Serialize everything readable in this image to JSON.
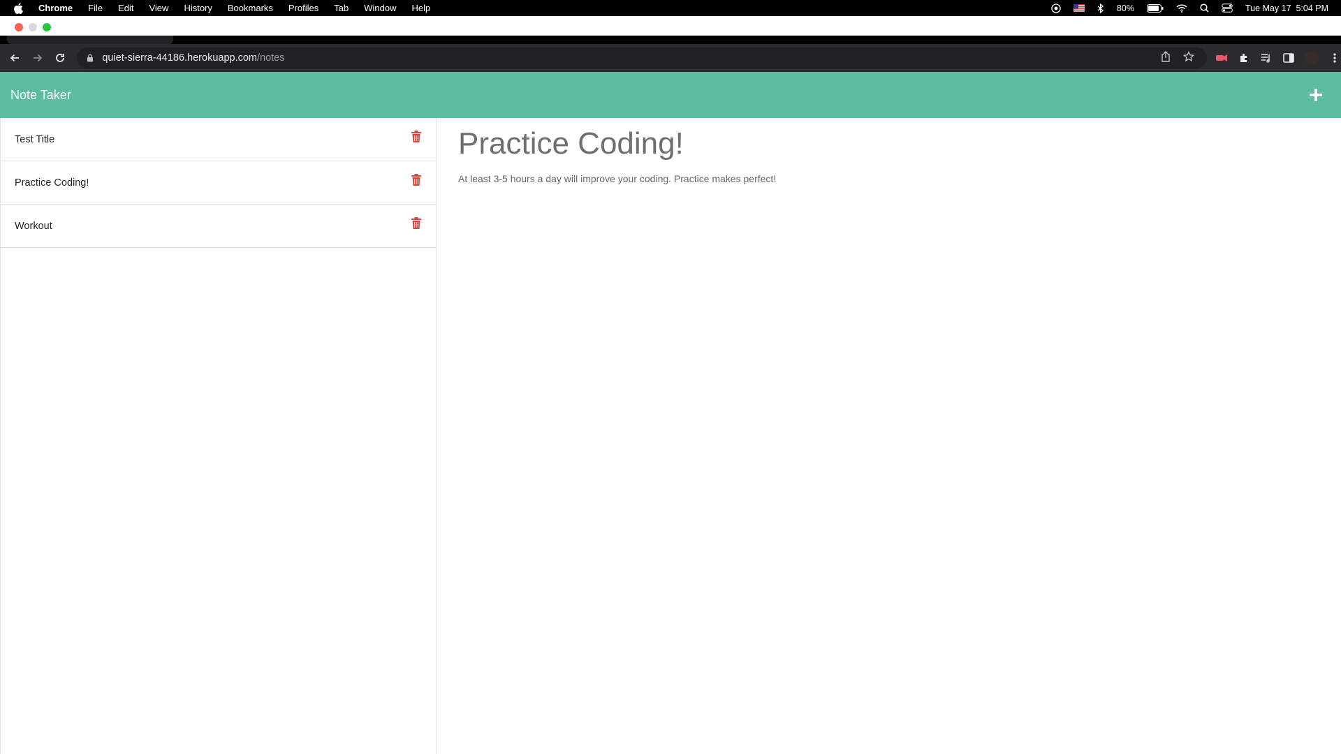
{
  "menubar": {
    "app_name": "Chrome",
    "items": [
      "File",
      "Edit",
      "View",
      "History",
      "Bookmarks",
      "Profiles",
      "Tab",
      "Window",
      "Help"
    ],
    "battery": "80%",
    "clock": "Tue May 17  5:04 PM"
  },
  "browser": {
    "url_host": "quiet-sierra-44186.herokuapp.com",
    "url_path": "/notes"
  },
  "app": {
    "title": "Note Taker",
    "colors": {
      "header": "#5cbc9f",
      "delete": "#d9463e"
    }
  },
  "notes": [
    {
      "title": "Test Title"
    },
    {
      "title": "Practice Coding!"
    },
    {
      "title": "Workout"
    }
  ],
  "active_note": {
    "title": "Practice Coding!",
    "text": "At least 3-5 hours a day will improve your coding. Practice makes perfect!"
  }
}
